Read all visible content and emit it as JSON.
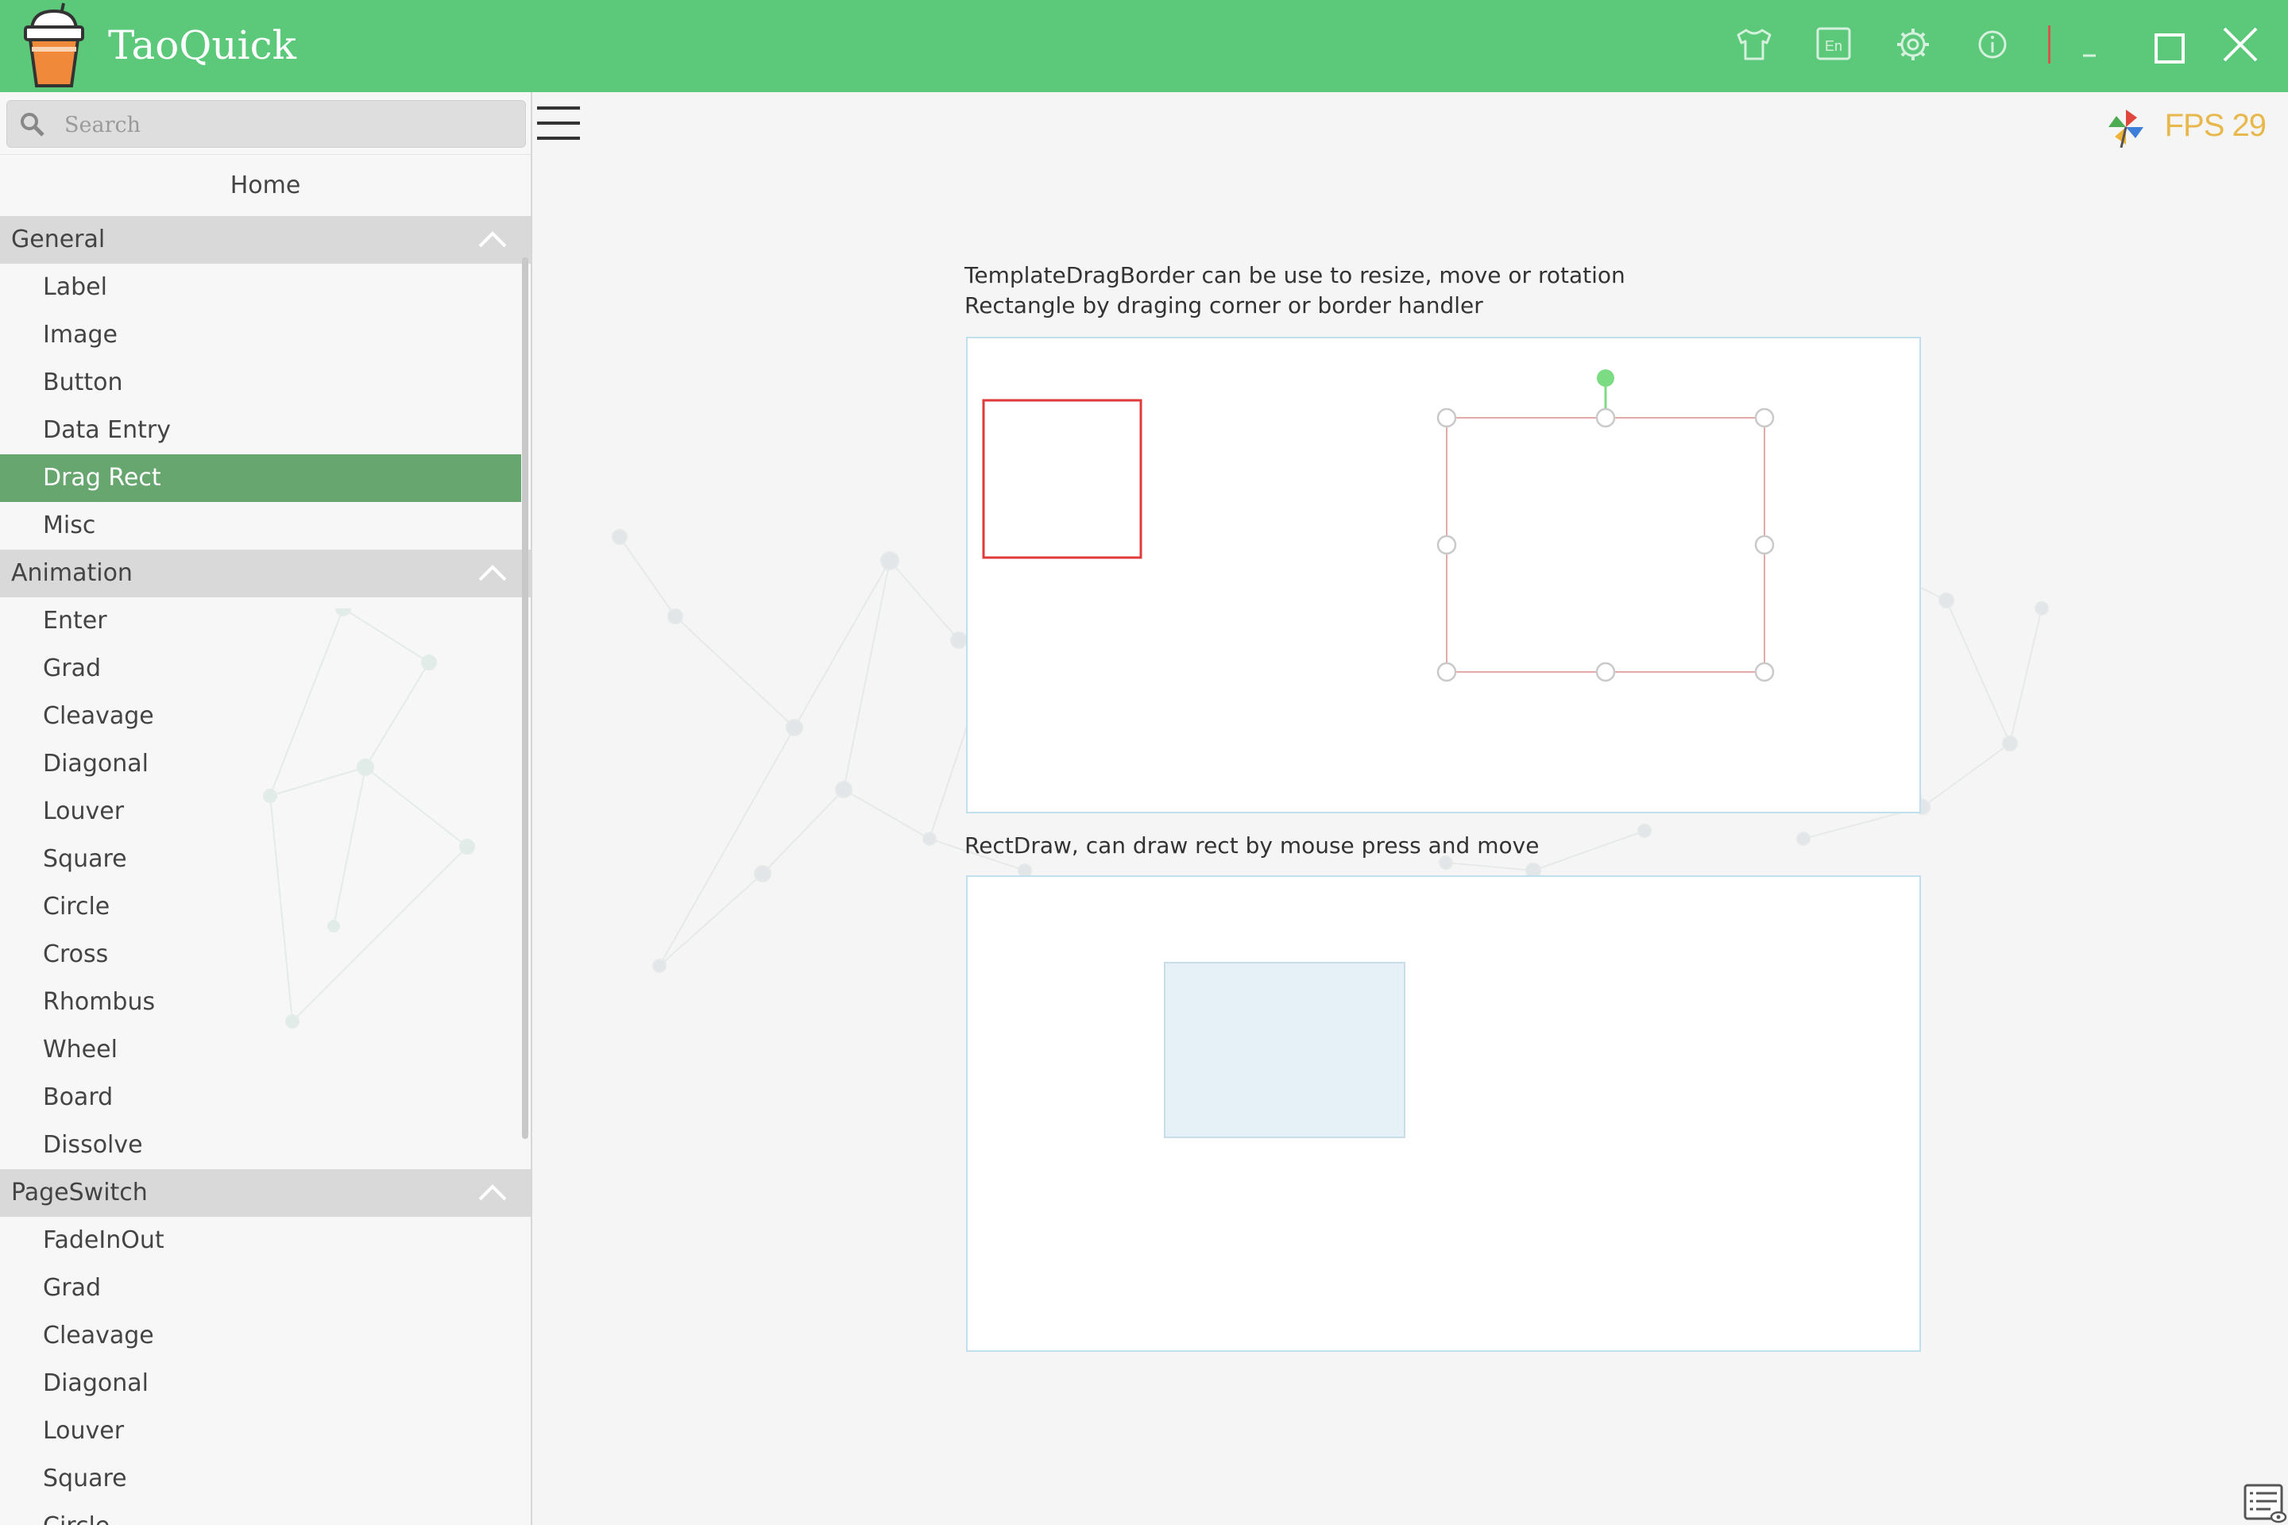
{
  "app": {
    "title": "TaoQuick"
  },
  "titlebar": {
    "buttons": [
      {
        "name": "skin-button",
        "icon": "shirt-icon"
      },
      {
        "name": "language-button",
        "icon": "language-en-icon"
      },
      {
        "name": "settings-button",
        "icon": "gear-icon"
      },
      {
        "name": "about-button",
        "icon": "info-icon"
      },
      {
        "name": "minimize-button",
        "icon": "minimize-icon"
      },
      {
        "name": "maximize-button",
        "icon": "maximize-icon"
      },
      {
        "name": "close-button",
        "icon": "close-icon"
      }
    ]
  },
  "sidebar": {
    "search": {
      "placeholder": "Search"
    },
    "home": "Home",
    "groups": [
      {
        "label": "General",
        "items": [
          "Label",
          "Image",
          "Button",
          "Data Entry",
          "Drag Rect",
          "Misc"
        ]
      },
      {
        "label": "Animation",
        "items": [
          "Enter",
          "Grad",
          "Cleavage",
          "Diagonal",
          "Louver",
          "Square",
          "Circle",
          "Cross",
          "Rhombus",
          "Wheel",
          "Board",
          "Dissolve"
        ]
      },
      {
        "label": "PageSwitch",
        "items": [
          "FadeInOut",
          "Grad",
          "Cleavage",
          "Diagonal",
          "Louver",
          "Square",
          "Circle"
        ]
      }
    ],
    "active_item": "Drag Rect"
  },
  "main": {
    "fps": "FPS 29",
    "drag_border": {
      "description_line1": "TemplateDragBorder can be use to resize, move or rotation",
      "description_line2": "Rectangle by draging corner or border handler"
    },
    "rect_draw": {
      "description": "RectDraw, can draw rect by mouse press and move"
    }
  },
  "colors": {
    "titlebar": "#5bc979",
    "active_item": "#67a76f",
    "fps": "#e8b84c",
    "red_rect": "#e03a3a",
    "handle_green": "#7cdc83",
    "drawn_rect_fill": "#e6f1f7"
  }
}
